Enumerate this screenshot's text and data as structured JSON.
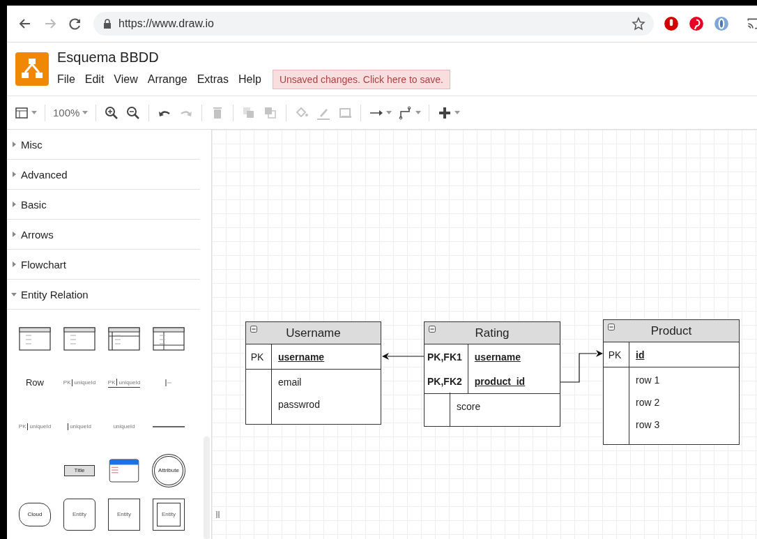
{
  "browser": {
    "url": "https://www.draw.io"
  },
  "app": {
    "title": "Esquema BBDD",
    "menus": [
      "File",
      "Edit",
      "View",
      "Arrange",
      "Extras",
      "Help"
    ],
    "notice": "Unsaved changes. Click here to save."
  },
  "toolbar": [
    {
      "kind": "layout",
      "disabled": false
    },
    {
      "kind": "sep"
    },
    {
      "kind": "zoom",
      "label": "100%",
      "disabled": false
    },
    {
      "kind": "sep"
    },
    {
      "kind": "zoom-in",
      "disabled": false
    },
    {
      "kind": "zoom-out",
      "disabled": false
    },
    {
      "kind": "sep"
    },
    {
      "kind": "undo",
      "disabled": false
    },
    {
      "kind": "redo",
      "disabled": true
    },
    {
      "kind": "sep"
    },
    {
      "kind": "delete",
      "disabled": true
    },
    {
      "kind": "sep"
    },
    {
      "kind": "to-front",
      "disabled": true
    },
    {
      "kind": "to-back",
      "disabled": true
    },
    {
      "kind": "sep"
    },
    {
      "kind": "fill",
      "disabled": true
    },
    {
      "kind": "line-color",
      "disabled": true
    },
    {
      "kind": "shadow",
      "disabled": true
    },
    {
      "kind": "sep"
    },
    {
      "kind": "connection",
      "disabled": false
    },
    {
      "kind": "waypoints",
      "disabled": false
    },
    {
      "kind": "sep"
    },
    {
      "kind": "insert",
      "disabled": false
    }
  ],
  "sidebar": {
    "sections": [
      {
        "label": "Misc",
        "expanded": false
      },
      {
        "label": "Advanced",
        "expanded": false
      },
      {
        "label": "Basic",
        "expanded": false
      },
      {
        "label": "Arrows",
        "expanded": false
      },
      {
        "label": "Flowchart",
        "expanded": false
      },
      {
        "label": "Entity Relation",
        "expanded": true
      }
    ],
    "shapes": [
      {
        "kind": "table"
      },
      {
        "kind": "table"
      },
      {
        "kind": "table-pk"
      },
      {
        "kind": "table-fk"
      },
      {
        "kind": "text",
        "label": "Row"
      },
      {
        "kind": "pk-row",
        "key": "PK",
        "label": "uniqueId"
      },
      {
        "kind": "pk-row-line",
        "key": "PK",
        "label": "uniqueId"
      },
      {
        "kind": "tick"
      },
      {
        "kind": "pk-row",
        "key": "PK",
        "label": "uniqueId"
      },
      {
        "kind": "bar-row",
        "label": "uniqueId"
      },
      {
        "kind": "plain-row",
        "label": "uniqueId"
      },
      {
        "kind": "line"
      },
      {
        "kind": "empty"
      },
      {
        "kind": "title",
        "label": "Title"
      },
      {
        "kind": "entity-blue"
      },
      {
        "kind": "attribute",
        "label": "Attribute"
      },
      {
        "kind": "cloud",
        "label": "Cloud"
      },
      {
        "kind": "entity-rounded",
        "label": "Entity"
      },
      {
        "kind": "entity",
        "label": "Entity"
      },
      {
        "kind": "entity-double",
        "label": "Entity"
      }
    ]
  },
  "diagram": {
    "tables": [
      {
        "title": "Username",
        "sections": [
          [
            {
              "key": "PK",
              "name": "username",
              "primary": true,
              "key_bold": false
            }
          ],
          [
            {
              "name": "email",
              "primary": false
            },
            {
              "name": "passwrod",
              "primary": false
            }
          ]
        ]
      },
      {
        "title": "Rating",
        "sections": [
          [
            {
              "key": "PK,FK1",
              "name": "username",
              "primary": true,
              "key_bold": true
            },
            {
              "key": "PK,FK2",
              "name": "product_id",
              "primary": true,
              "key_bold": true
            }
          ],
          [
            {
              "name": "score",
              "primary": false
            }
          ]
        ]
      },
      {
        "title": "Product",
        "sections": [
          [
            {
              "key": "PK",
              "name": "id",
              "primary": true,
              "key_bold": false
            }
          ],
          [
            {
              "name": "row 1",
              "primary": false
            },
            {
              "name": "row 2",
              "primary": false
            },
            {
              "name": "row 3",
              "primary": false
            }
          ]
        ]
      }
    ]
  }
}
